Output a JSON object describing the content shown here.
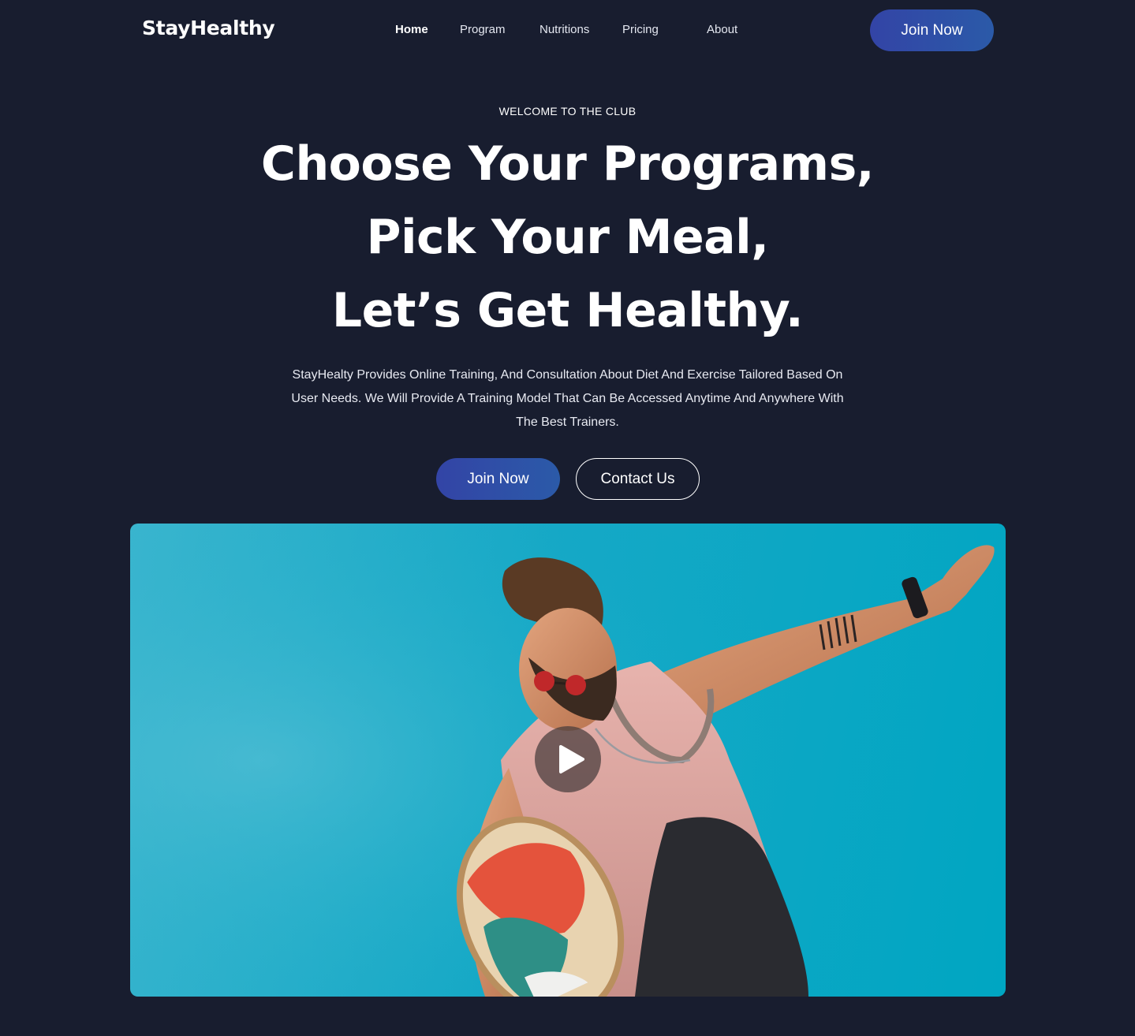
{
  "brand": {
    "logo": "StayHealthy"
  },
  "nav": {
    "items": [
      {
        "label": "Home",
        "active": true
      },
      {
        "label": "Program"
      },
      {
        "label": "Nutritions"
      },
      {
        "label": "Pricing"
      },
      {
        "label": "About"
      }
    ],
    "cta_label": "Join Now"
  },
  "hero": {
    "eyebrow": "WELCOME TO THE CLUB",
    "headline": [
      "Choose Your Programs,",
      "Pick Your Meal,",
      "Let’s Get Healthy."
    ],
    "description": "StayHealty Provides Online Training, And Consultation About Diet And Exercise Tailored Based On User Needs. We Will Provide A Training Model That Can Be Accessed Anytime And Anywhere With The Best Trainers.",
    "primary_label": "Join Now",
    "secondary_label": "Contact Us"
  },
  "video": {
    "play_icon": "play-icon"
  },
  "colors": {
    "background": "#181d2f",
    "accent_start": "#3344a6",
    "accent_end": "#2b5aa8",
    "video_sky": "#16a8c6"
  }
}
